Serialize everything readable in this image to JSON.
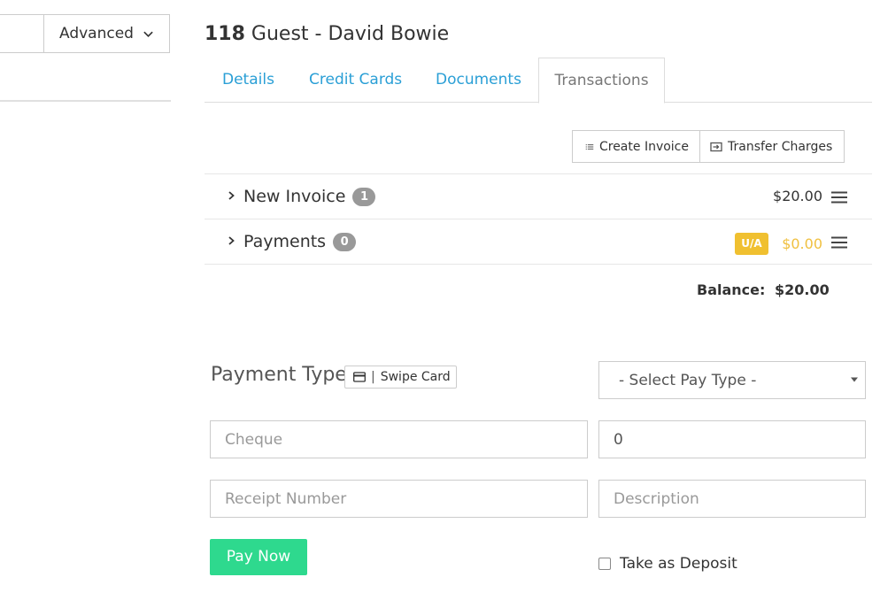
{
  "header": {
    "advanced_label": "Advanced",
    "title_number": "118",
    "title_rest": " Guest - David Bowie"
  },
  "tabs": [
    {
      "label": "Details",
      "active": false
    },
    {
      "label": "Credit Cards",
      "active": false
    },
    {
      "label": "Documents",
      "active": false
    },
    {
      "label": "Transactions",
      "active": true
    }
  ],
  "actions": {
    "create_invoice": "Create Invoice",
    "transfer_charges": "Transfer Charges"
  },
  "rows": [
    {
      "label": "New Invoice",
      "count": "1",
      "amount": "$20.00"
    },
    {
      "label": "Payments",
      "count": "0",
      "badge": "U/A",
      "amount": "$0.00"
    }
  ],
  "balance": {
    "label": "Balance:",
    "value": "$20.00"
  },
  "payment": {
    "type_label": "Payment Type",
    "swipe_label": "Swipe Card",
    "select_value": "- Select Pay Type -",
    "cheque_placeholder": "Cheque",
    "amount_value": "0",
    "receipt_placeholder": "Receipt Number",
    "description_placeholder": "Description",
    "pay_now": "Pay Now",
    "deposit_label": "Take as Deposit"
  },
  "colors": {
    "link": "#2a9fd6",
    "warning": "#f0c030",
    "success": "#2ed98e",
    "badge_gray": "#999999"
  }
}
